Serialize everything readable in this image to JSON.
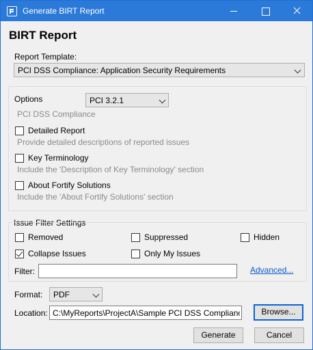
{
  "window": {
    "title": "Generate BIRT Report"
  },
  "heading": "BIRT Report",
  "report_template": {
    "label": "Report Template:",
    "value": "PCI DSS Compliance: Application Security Requirements"
  },
  "options": {
    "label": "Options",
    "version_value": "PCI 3.2.1",
    "subtitle": "PCI DSS Compliance",
    "items": [
      {
        "label": "Detailed Report",
        "description": "Provide detailed descriptions of reported issues",
        "checked": false
      },
      {
        "label": "Key Terminology",
        "description": "Include the 'Description of Key Terminology' section",
        "checked": false
      },
      {
        "label": "About Fortify Solutions",
        "description": "Include the 'About Fortify Solutions' section",
        "checked": false
      }
    ]
  },
  "issue_filter": {
    "title": "Issue Filter Settings",
    "removed": {
      "label": "Removed",
      "checked": false
    },
    "suppressed": {
      "label": "Suppressed",
      "checked": false
    },
    "hidden": {
      "label": "Hidden",
      "checked": false
    },
    "collapse": {
      "label": "Collapse Issues",
      "checked": true
    },
    "only_my": {
      "label": "Only My Issues",
      "checked": false
    },
    "filter_label": "Filter:",
    "filter_value": "",
    "advanced_link": "Advanced..."
  },
  "format": {
    "label": "Format:",
    "value": "PDF"
  },
  "location": {
    "label": "Location:",
    "value": "C:\\MyReports\\ProjectA\\Sample PCI DSS Compliance  Ap",
    "browse_label": "Browse..."
  },
  "actions": {
    "generate_label": "Generate",
    "cancel_label": "Cancel"
  }
}
